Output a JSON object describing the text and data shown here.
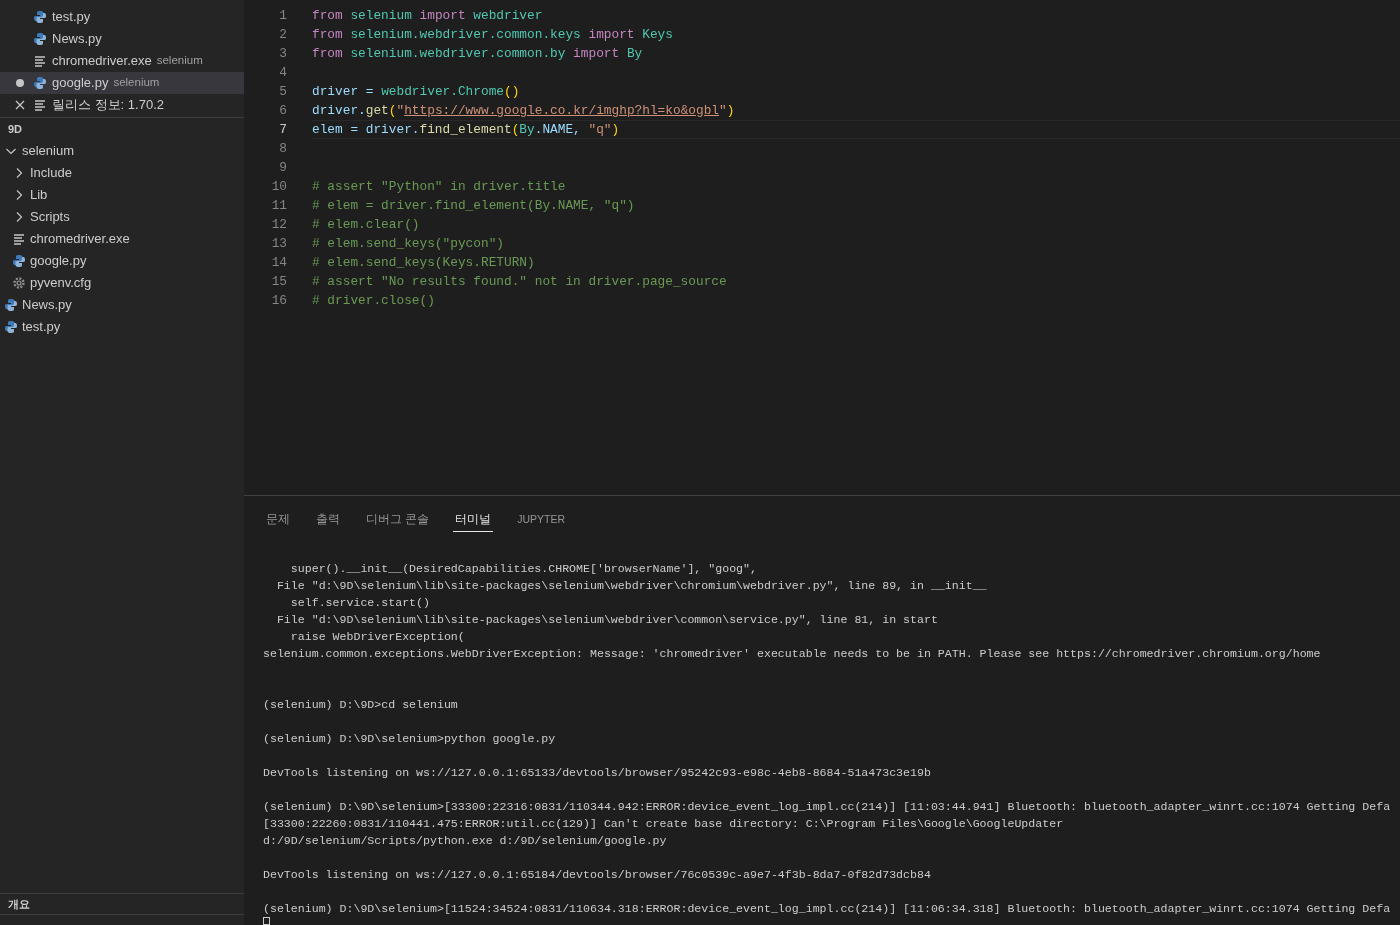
{
  "open_editors": [
    {
      "name": "test.py",
      "kind": "python",
      "selected": false,
      "modified": false,
      "hovered": false
    },
    {
      "name": "News.py",
      "kind": "python",
      "selected": false,
      "modified": false,
      "hovered": false
    },
    {
      "name": "chromedriver.exe",
      "description": "selenium",
      "kind": "file",
      "selected": false,
      "modified": false,
      "hovered": false
    },
    {
      "name": "google.py",
      "description": "selenium",
      "kind": "python",
      "selected": true,
      "modified": true,
      "hovered": false
    },
    {
      "name": "릴리스 정보: 1.70.2",
      "kind": "file",
      "selected": false,
      "modified": false,
      "hovered": true
    }
  ],
  "explorer": {
    "root": "9D",
    "tree": [
      {
        "name": "selenium",
        "kind": "folder",
        "expanded": true,
        "children": [
          {
            "name": "Include",
            "kind": "folder",
            "expanded": false
          },
          {
            "name": "Lib",
            "kind": "folder",
            "expanded": false
          },
          {
            "name": "Scripts",
            "kind": "folder",
            "expanded": false
          },
          {
            "name": "chromedriver.exe",
            "kind": "file"
          },
          {
            "name": "google.py",
            "kind": "python"
          },
          {
            "name": "pyvenv.cfg",
            "kind": "config"
          }
        ]
      },
      {
        "name": "News.py",
        "kind": "python"
      },
      {
        "name": "test.py",
        "kind": "python"
      }
    ]
  },
  "outline": {
    "title": "개요"
  },
  "editor": {
    "lines": [
      {
        "number": "1",
        "current": false,
        "tokens": [
          {
            "t": "from ",
            "kind": "kw"
          },
          {
            "t": "selenium ",
            "kind": "mod"
          },
          {
            "t": "import ",
            "kind": "kw"
          },
          {
            "t": "webdriver",
            "kind": "mod"
          }
        ]
      },
      {
        "number": "2",
        "current": false,
        "tokens": [
          {
            "t": "from ",
            "kind": "kw"
          },
          {
            "t": "selenium.webdriver.common.keys ",
            "kind": "mod"
          },
          {
            "t": "import ",
            "kind": "kw"
          },
          {
            "t": "Keys",
            "kind": "cls"
          }
        ]
      },
      {
        "number": "3",
        "current": false,
        "tokens": [
          {
            "t": "from ",
            "kind": "kw"
          },
          {
            "t": "selenium.webdriver.common.by ",
            "kind": "mod"
          },
          {
            "t": "import ",
            "kind": "kw"
          },
          {
            "t": "By",
            "kind": "cls"
          }
        ]
      },
      {
        "number": "4",
        "current": false
      },
      {
        "number": "5",
        "current": false,
        "tokens": [
          {
            "t": "driver = ",
            "kind": "var"
          },
          {
            "t": "webdriver.",
            "kind": "mod"
          },
          {
            "t": "Chrome",
            "kind": "cls"
          },
          {
            "t": "()",
            "kind": "br"
          }
        ]
      },
      {
        "number": "6",
        "current": false,
        "tokens": [
          {
            "t": "driver.",
            "kind": "var"
          },
          {
            "t": "get",
            "kind": "fn"
          },
          {
            "t": "(",
            "kind": "br"
          },
          {
            "t": "\"",
            "kind": "str"
          },
          {
            "t": "https://www.google.co.kr/imghp?hl=ko&ogbl",
            "kind": "link"
          },
          {
            "t": "\"",
            "kind": "str"
          },
          {
            "t": ")",
            "kind": "br"
          }
        ]
      },
      {
        "number": "7",
        "current": true,
        "tokens": [
          {
            "t": "elem = driver.",
            "kind": "var"
          },
          {
            "t": "find_element",
            "kind": "fn"
          },
          {
            "t": "(",
            "kind": "br"
          },
          {
            "t": "By",
            "kind": "cls"
          },
          {
            "t": ".NAME, ",
            "kind": "var"
          },
          {
            "t": "\"q\"",
            "kind": "str"
          },
          {
            "t": ")",
            "kind": "br"
          }
        ]
      },
      {
        "number": "8",
        "current": false
      },
      {
        "number": "9",
        "current": false
      },
      {
        "number": "10",
        "current": false,
        "tokens": [
          {
            "t": "# assert \"Python\" in driver.title",
            "kind": "com"
          }
        ]
      },
      {
        "number": "11",
        "current": false,
        "tokens": [
          {
            "t": "# elem = driver.find_element(By.NAME, \"q\")",
            "kind": "com"
          }
        ]
      },
      {
        "number": "12",
        "current": false,
        "tokens": [
          {
            "t": "# elem.clear()",
            "kind": "com"
          }
        ]
      },
      {
        "number": "13",
        "current": false,
        "tokens": [
          {
            "t": "# elem.send_keys(\"pycon\")",
            "kind": "com"
          }
        ]
      },
      {
        "number": "14",
        "current": false,
        "tokens": [
          {
            "t": "# elem.send_keys(Keys.RETURN)",
            "kind": "com"
          }
        ]
      },
      {
        "number": "15",
        "current": false,
        "tokens": [
          {
            "t": "# assert \"No results found.\" not in driver.page_source",
            "kind": "com"
          }
        ]
      },
      {
        "number": "16",
        "current": false,
        "tokens": [
          {
            "t": "# driver.close()",
            "kind": "com"
          }
        ]
      }
    ]
  },
  "panel": {
    "tabs": [
      {
        "label": "문제",
        "selected": false
      },
      {
        "label": "출력",
        "selected": false
      },
      {
        "label": "디버그 콘솔",
        "selected": false
      },
      {
        "label": "터미널",
        "selected": true
      },
      {
        "label": "JUPYTER",
        "selected": false
      }
    ],
    "terminal": [
      {
        "kind": "text",
        "text": "    super().__init__(DesiredCapabilities.CHROME['browserName'], \"goog\","
      },
      {
        "kind": "text",
        "text": "  File \"d:\\9D\\selenium\\lib\\site-packages\\selenium\\webdriver\\chromium\\webdriver.py\", line 89, in __init__"
      },
      {
        "kind": "text",
        "text": "    self.service.start()"
      },
      {
        "kind": "text",
        "text": "  File \"d:\\9D\\selenium\\lib\\site-packages\\selenium\\webdriver\\common\\service.py\", line 81, in start"
      },
      {
        "kind": "text",
        "text": "    raise WebDriverException("
      },
      {
        "kind": "text",
        "text": "selenium.common.exceptions.WebDriverException: Message: 'chromedriver' executable needs to be in PATH. Please see https://chromedriver.chromium.org/home"
      },
      {
        "kind": "blank"
      },
      {
        "kind": "blank"
      },
      {
        "kind": "text",
        "text": "(selenium) D:\\9D>cd selenium"
      },
      {
        "kind": "blank"
      },
      {
        "kind": "text",
        "text": "(selenium) D:\\9D\\selenium>python google.py"
      },
      {
        "kind": "blank"
      },
      {
        "kind": "text",
        "text": "DevTools listening on ws://127.0.0.1:65133/devtools/browser/95242c93-e98c-4eb8-8684-51a473c3e19b"
      },
      {
        "kind": "blank"
      },
      {
        "kind": "text",
        "text": "(selenium) D:\\9D\\selenium>[33300:22316:0831/110344.942:ERROR:device_event_log_impl.cc(214)] [11:03:44.941] Bluetooth: bluetooth_adapter_winrt.cc:1074 Getting Defa"
      },
      {
        "kind": "text",
        "text": "[33300:22260:0831/110441.475:ERROR:util.cc(129)] Can't create base directory: C:\\Program Files\\Google\\GoogleUpdater"
      },
      {
        "kind": "text",
        "text": "d:/9D/selenium/Scripts/python.exe d:/9D/selenium/google.py"
      },
      {
        "kind": "blank"
      },
      {
        "kind": "text",
        "text": "DevTools listening on ws://127.0.0.1:65184/devtools/browser/76c0539c-a9e7-4f3b-8da7-0f82d73dcb84"
      },
      {
        "kind": "blank"
      },
      {
        "kind": "text",
        "text": "(selenium) D:\\9D\\selenium>[11524:34524:0831/110634.318:ERROR:device_event_log_impl.cc(214)] [11:06:34.318] Bluetooth: bluetooth_adapter_winrt.cc:1074 Getting Defa"
      }
    ]
  }
}
